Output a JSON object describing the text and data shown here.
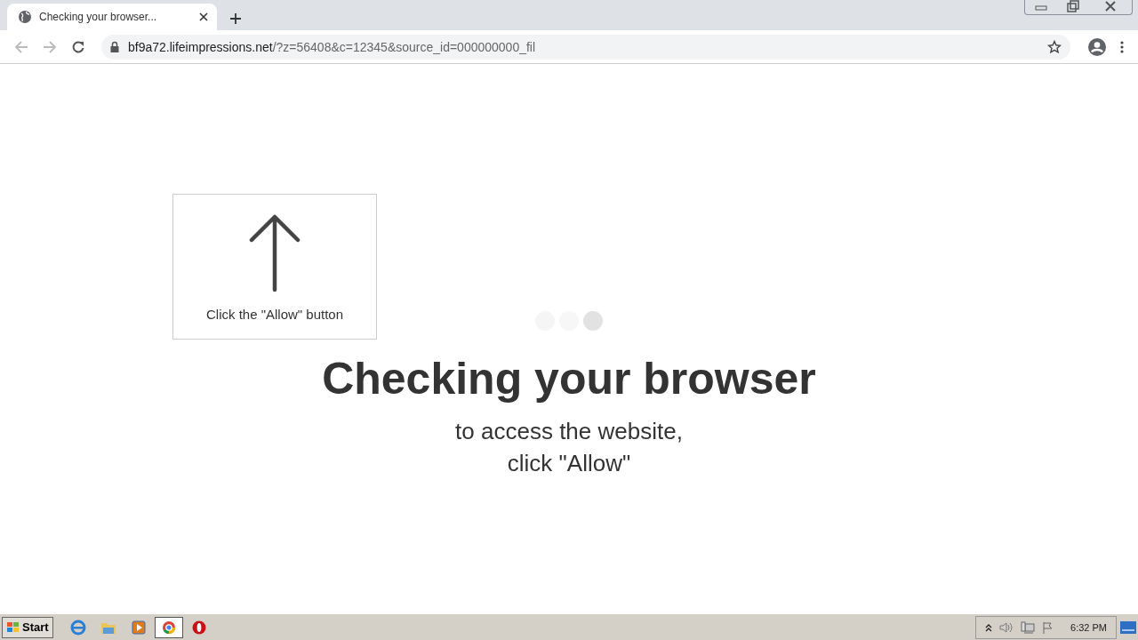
{
  "tab": {
    "title": "Checking your browser...",
    "selected": true
  },
  "address_bar": {
    "host": "bf9a72.lifeimpressions.net",
    "path": "/?z=56408&c=12345&source_id=000000000_fil"
  },
  "hint_box": {
    "text": "Click the \"Allow\" button"
  },
  "heading": "Checking your browser",
  "subtext": [
    "to access the website,",
    "click \"Allow\""
  ],
  "taskbar": {
    "start": "Start",
    "apps": [
      {
        "kind": "ie",
        "selected": false
      },
      {
        "kind": "folder",
        "selected": false
      },
      {
        "kind": "media",
        "selected": false
      },
      {
        "kind": "chrome",
        "selected": true
      },
      {
        "kind": "opera",
        "selected": false
      }
    ],
    "clock": "6:32 PM"
  }
}
